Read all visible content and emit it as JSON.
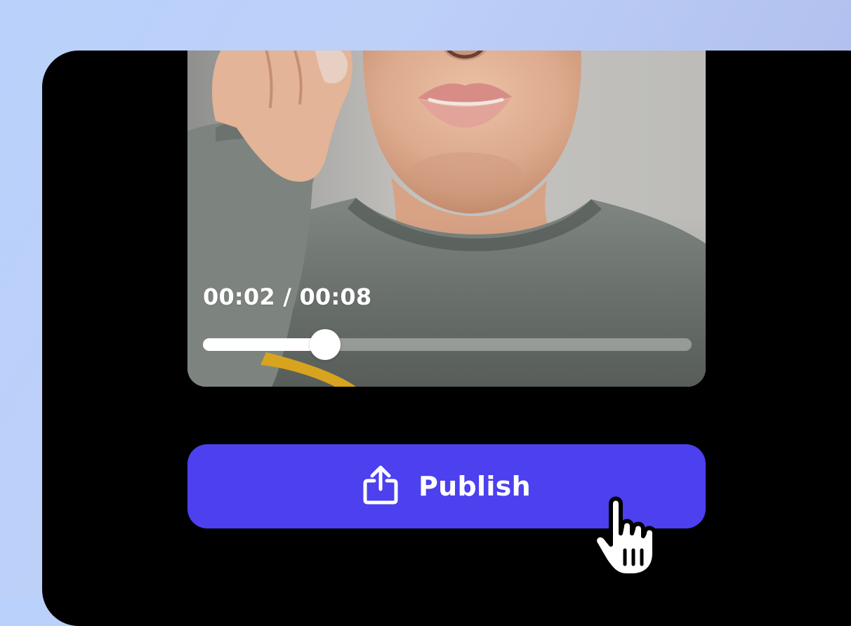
{
  "video": {
    "current_time": "00:02",
    "separator": " / ",
    "duration": "00:08",
    "time_display": "00:02 / 00:08",
    "progress": 0.25
  },
  "publish": {
    "label": "Publish",
    "icon": "share-upload-icon"
  },
  "colors": {
    "accent": "#4c40ef",
    "background_gradient_start": "#b9d1fb",
    "background_gradient_end": "#a8b2e9",
    "device_frame": "#000000"
  },
  "cursor": {
    "icon": "hand-pointer-cursor"
  }
}
